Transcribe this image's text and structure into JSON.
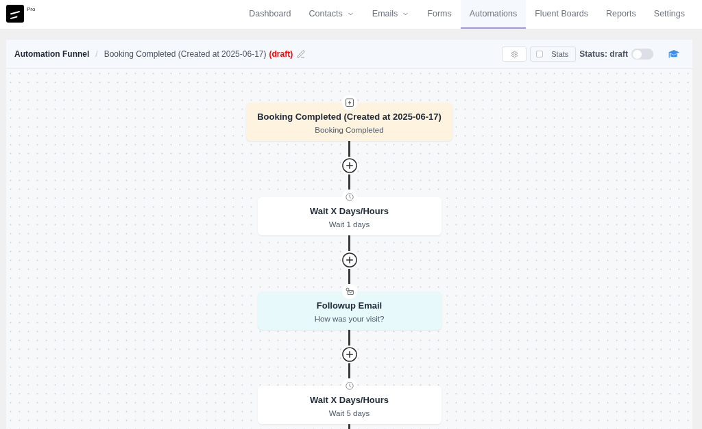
{
  "brand": {
    "badge": "Pro"
  },
  "nav": [
    {
      "label": "Dashboard",
      "selected": false,
      "dropdown": false
    },
    {
      "label": "Contacts",
      "selected": false,
      "dropdown": true
    },
    {
      "label": "Emails",
      "selected": false,
      "dropdown": true
    },
    {
      "label": "Forms",
      "selected": false,
      "dropdown": false
    },
    {
      "label": "Automations",
      "selected": true,
      "dropdown": false
    },
    {
      "label": "Fluent Boards",
      "selected": false,
      "dropdown": false
    },
    {
      "label": "Reports",
      "selected": false,
      "dropdown": false
    },
    {
      "label": "Settings",
      "selected": false,
      "dropdown": false
    }
  ],
  "header": {
    "breadcrumb": "Automation Funnel",
    "separator": "/",
    "title": "Booking Completed (Created at 2025-06-17)",
    "tag": "(draft)",
    "stats": {
      "label": "Stats",
      "checked": false
    },
    "status": {
      "label": "Status: draft",
      "on": false
    }
  },
  "funnel": [
    {
      "kind": "trigger",
      "title": "Booking Completed (Created at 2025-06-17)",
      "subtitle": "Booking Completed"
    },
    {
      "kind": "wait",
      "title": "Wait X Days/Hours",
      "subtitle": "Wait 1 days"
    },
    {
      "kind": "email",
      "title": "Followup Email",
      "subtitle": "How was your visit?"
    },
    {
      "kind": "wait",
      "title": "Wait X Days/Hours",
      "subtitle": "Wait 5 days"
    }
  ]
}
